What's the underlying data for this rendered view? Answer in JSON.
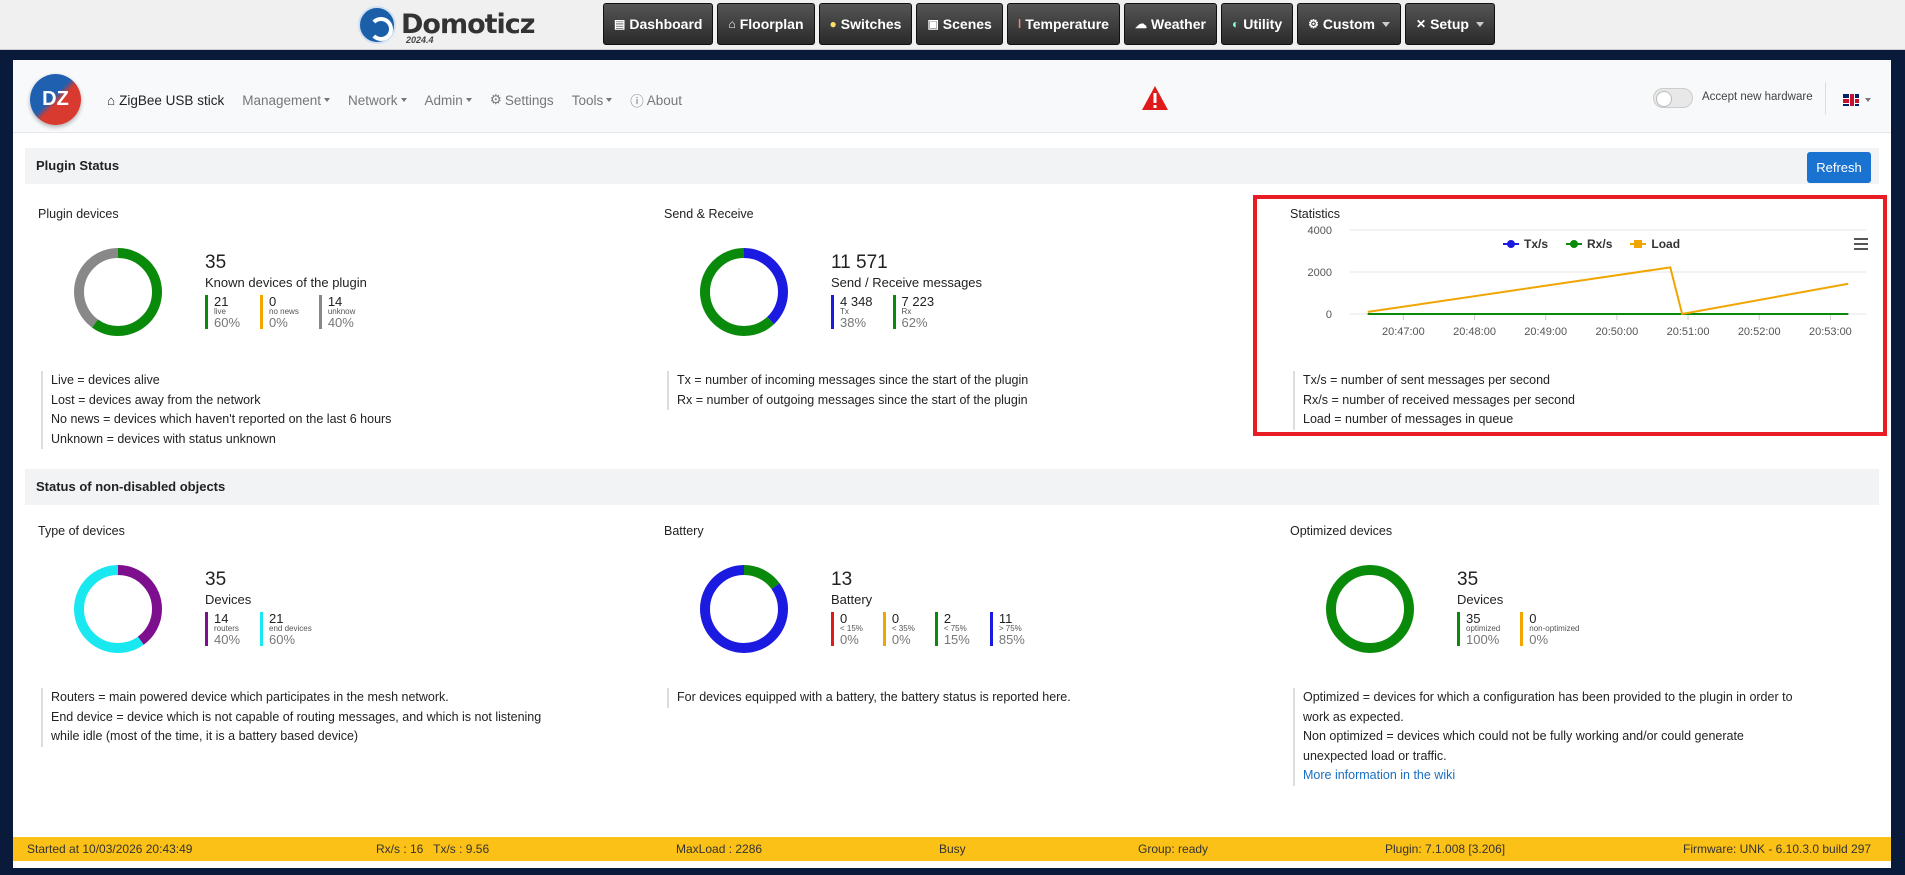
{
  "app": {
    "name": "Domoticz",
    "version": "2024.4"
  },
  "topnav": [
    {
      "label": "Dashboard",
      "icon": "dashboard-icon"
    },
    {
      "label": "Floorplan",
      "icon": "floorplan-icon"
    },
    {
      "label": "Switches",
      "icon": "bulb-icon"
    },
    {
      "label": "Scenes",
      "icon": "scenes-icon"
    },
    {
      "label": "Temperature",
      "icon": "thermometer-icon"
    },
    {
      "label": "Weather",
      "icon": "weather-icon"
    },
    {
      "label": "Utility",
      "icon": "utility-icon"
    },
    {
      "label": "Custom",
      "icon": "gear-icon",
      "dropdown": true
    },
    {
      "label": "Setup",
      "icon": "tools-icon",
      "dropdown": true
    }
  ],
  "plugin": {
    "logo": "DZ",
    "nav": {
      "home": "ZigBee USB stick",
      "management": "Management",
      "network": "Network",
      "admin": "Admin",
      "settings": "Settings",
      "tools": "Tools",
      "about": "About"
    },
    "accept_hardware": "Accept new hardware",
    "accept_enabled": false
  },
  "plugin_status": {
    "title": "Plugin Status",
    "refresh": "Refresh",
    "devices": {
      "title": "Plugin devices",
      "total": "35",
      "desc": "Known devices of the plugin",
      "stats": [
        {
          "n": "21",
          "l": "live",
          "p": "60%",
          "color": "#0a8a0a",
          "frac": 0.6
        },
        {
          "n": "0",
          "l": "no news",
          "p": "0%",
          "color": "#f0a500",
          "frac": 0
        },
        {
          "n": "14",
          "l": "unknow",
          "p": "40%",
          "color": "#888888",
          "frac": 0.4
        }
      ],
      "notes": [
        "Live = devices alive",
        "Lost = devices away from the network",
        "No news = devices which haven't reported on the last 6 hours",
        "Unknown = devices with status unknown"
      ]
    },
    "sendrecv": {
      "title": "Send & Receive",
      "total": "11 571",
      "desc": "Send / Receive messages",
      "stats": [
        {
          "n": "4 348",
          "l": "Tx",
          "p": "38%",
          "color": "#1a1ae0",
          "frac": 0.38
        },
        {
          "n": "7 223",
          "l": "Rx",
          "p": "62%",
          "color": "#0a8a0a",
          "frac": 0.62
        }
      ],
      "notes": [
        "Tx = number of incoming messages since the start of the plugin",
        "Rx = number of outgoing messages since the start of the plugin"
      ]
    },
    "statistics": {
      "title": "Statistics",
      "notes": [
        "Tx/s = number of sent messages per second",
        "Rx/s = number of received messages per second",
        "Load = number of messages in queue"
      ]
    }
  },
  "chart_data": {
    "type": "line",
    "title": "",
    "x": [
      "20:46:30",
      "20:50:45",
      "20:50:55",
      "20:53:15"
    ],
    "xticks": [
      "20:47:00",
      "20:48:00",
      "20:49:00",
      "20:50:00",
      "20:51:00",
      "20:52:00",
      "20:53:00"
    ],
    "yticks": [
      "0",
      "2000",
      "4000"
    ],
    "ylim": [
      0,
      4000
    ],
    "series": [
      {
        "name": "Tx/s",
        "color": "#1a1ae0",
        "values": [
          0,
          0,
          0,
          0
        ]
      },
      {
        "name": "Rx/s",
        "color": "#0a8a0a",
        "values": [
          0,
          0,
          0,
          0
        ]
      },
      {
        "name": "Load",
        "color": "#f0a500",
        "values": [
          100,
          2220,
          0,
          1440
        ]
      }
    ],
    "legend": "top"
  },
  "nondisabled": {
    "title": "Status of non-disabled objects",
    "types": {
      "title": "Type of devices",
      "total": "35",
      "desc": "Devices",
      "stats": [
        {
          "n": "14",
          "l": "routers",
          "p": "40%",
          "color": "#7d0f8f",
          "frac": 0.4
        },
        {
          "n": "21",
          "l": "end devices",
          "p": "60%",
          "color": "#1ae8f0",
          "frac": 0.6
        }
      ],
      "notes": [
        "Routers = main powered device which participates in the mesh network.",
        "End device = device which is not capable of routing messages, and which is not listening",
        "while idle (most of the time, it is a battery based device)"
      ]
    },
    "battery": {
      "title": "Battery",
      "total": "13",
      "desc": "Battery",
      "stats": [
        {
          "n": "0",
          "l": "< 15%",
          "p": "0%",
          "color": "#e01a1a",
          "frac": 0
        },
        {
          "n": "0",
          "l": "< 35%",
          "p": "0%",
          "color": "#f0a500",
          "frac": 0
        },
        {
          "n": "2",
          "l": "< 75%",
          "p": "15%",
          "color": "#0a8a0a",
          "frac": 0.15
        },
        {
          "n": "11",
          "l": "> 75%",
          "p": "85%",
          "color": "#1a1ae0",
          "frac": 0.85
        }
      ],
      "notes": [
        "For devices equipped with a battery, the battery status is reported here."
      ]
    },
    "optimized": {
      "title": "Optimized devices",
      "total": "35",
      "desc": "Devices",
      "stats": [
        {
          "n": "35",
          "l": "optimized",
          "p": "100%",
          "color": "#0a8a0a",
          "frac": 1
        },
        {
          "n": "0",
          "l": "non-optimized",
          "p": "0%",
          "color": "#f0a500",
          "frac": 0
        }
      ],
      "notes": [
        "Optimized = devices for which a configuration has been provided to the plugin in order to",
        "work as expected.",
        "Non optimized = devices which could not be fully working and/or could generate",
        "unexpected load or traffic."
      ],
      "link": "More information in the wiki"
    }
  },
  "footer": {
    "started": "Started at 10/03/2026 20:43:49",
    "rates": "Rx/s : 16   Tx/s : 9.56",
    "maxload": "MaxLoad : 2286",
    "busy": "Busy",
    "group": "Group: ready",
    "plugin": "Plugin: 7.1.008 [3.206]",
    "firmware": "Firmware: UNK - 6.10.3.0 build 297"
  }
}
